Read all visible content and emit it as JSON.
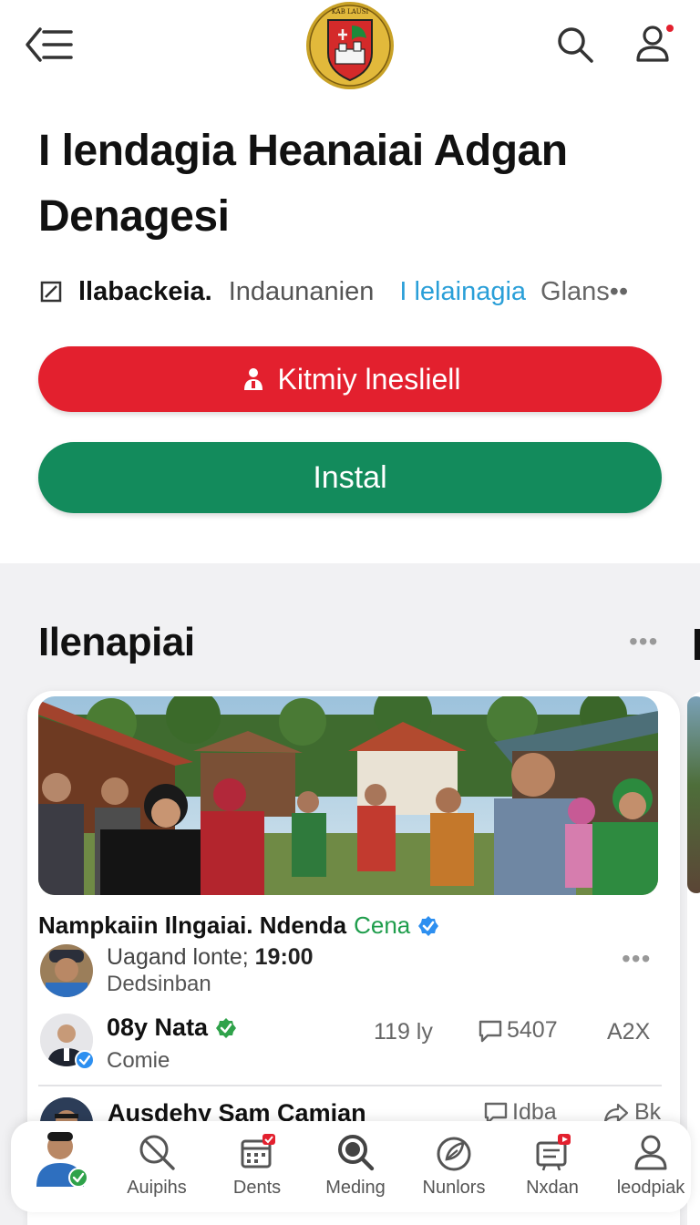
{
  "header": {
    "back_icon": "back-menu-icon",
    "emblem_label": "KAB LAUSI",
    "search_icon": "search-icon",
    "profile_icon": "user-icon",
    "notification_color": "#e3202e"
  },
  "article": {
    "title": "I lendagia Heanaiai Adgan Denagesi",
    "author": "llabackeia.",
    "category": "Indaunanien",
    "link": "I lelainagia",
    "more": "Glans••",
    "primary_button": "Kitmiy lnesliell",
    "secondary_button": "Instal"
  },
  "feed": {
    "section_title": "Ilenapiai",
    "more_label": "•••",
    "card": {
      "headline": "Nampkaiin Ilngaiai. Ndenda",
      "source": "Cena",
      "row1": {
        "prefix": "Uagand lonte;",
        "time": "19:00",
        "subtitle": "Dedsinban",
        "more": "•••"
      },
      "row2": {
        "name": "08y Nata",
        "subtitle": "Comie",
        "count": "119 ly",
        "comments": "5407",
        "share": "A2X"
      },
      "row3": {
        "name": "Ausdehy Sam Camian",
        "comments": "Idba",
        "share": "Bk"
      }
    }
  },
  "bottom_nav": {
    "items": [
      {
        "label": "Auipihs",
        "icon": "search-off-icon"
      },
      {
        "label": "Dents",
        "icon": "calendar-icon"
      },
      {
        "label": "Meding",
        "icon": "search-icon"
      },
      {
        "label": "Nunlors",
        "icon": "leaf-icon"
      },
      {
        "label": "Nxdan",
        "icon": "news-icon"
      },
      {
        "label": "leodpiak",
        "icon": "profile-icon"
      }
    ]
  },
  "colors": {
    "accent_red": "#e3202e",
    "accent_green": "#138b5c",
    "link_blue": "#2a9fd8",
    "verified_blue": "#2d8ff0",
    "verified_green": "#2fa24a"
  }
}
